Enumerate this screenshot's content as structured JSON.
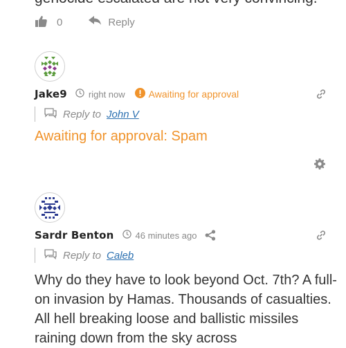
{
  "previous_comment": {
    "text_tail": "genocide escalated are not very convincing.",
    "like_count": "0",
    "reply_label": "Reply"
  },
  "comment_jake": {
    "author": "Jake9",
    "time": "right now",
    "awaiting_label": "Awaiting for approval",
    "reply_to_prefix": "Reply to",
    "reply_to_name": "John V",
    "body": "Awaiting for approval: Spam"
  },
  "comment_sardr": {
    "author": "Sardr Benton",
    "time": "46 minutes ago",
    "reply_to_prefix": "Reply to",
    "reply_to_name": "Caleb",
    "body": "Why do they have to look beyond Oct. 7th? A full-on invasion by Hamas. Thousands of casualties. All hell breaking loose and ballistic missiles raining down from the sky across"
  },
  "colors": {
    "awaiting": "#f0932b",
    "link": "#2a6fb0",
    "muted": "#8a8a8a"
  },
  "icons": [
    "thumbs-up-icon",
    "reply-arrow-icon",
    "clock-icon",
    "exclamation-circle-icon",
    "chain-link-icon",
    "comment-bubble-icon",
    "gear-icon",
    "share-icon"
  ]
}
